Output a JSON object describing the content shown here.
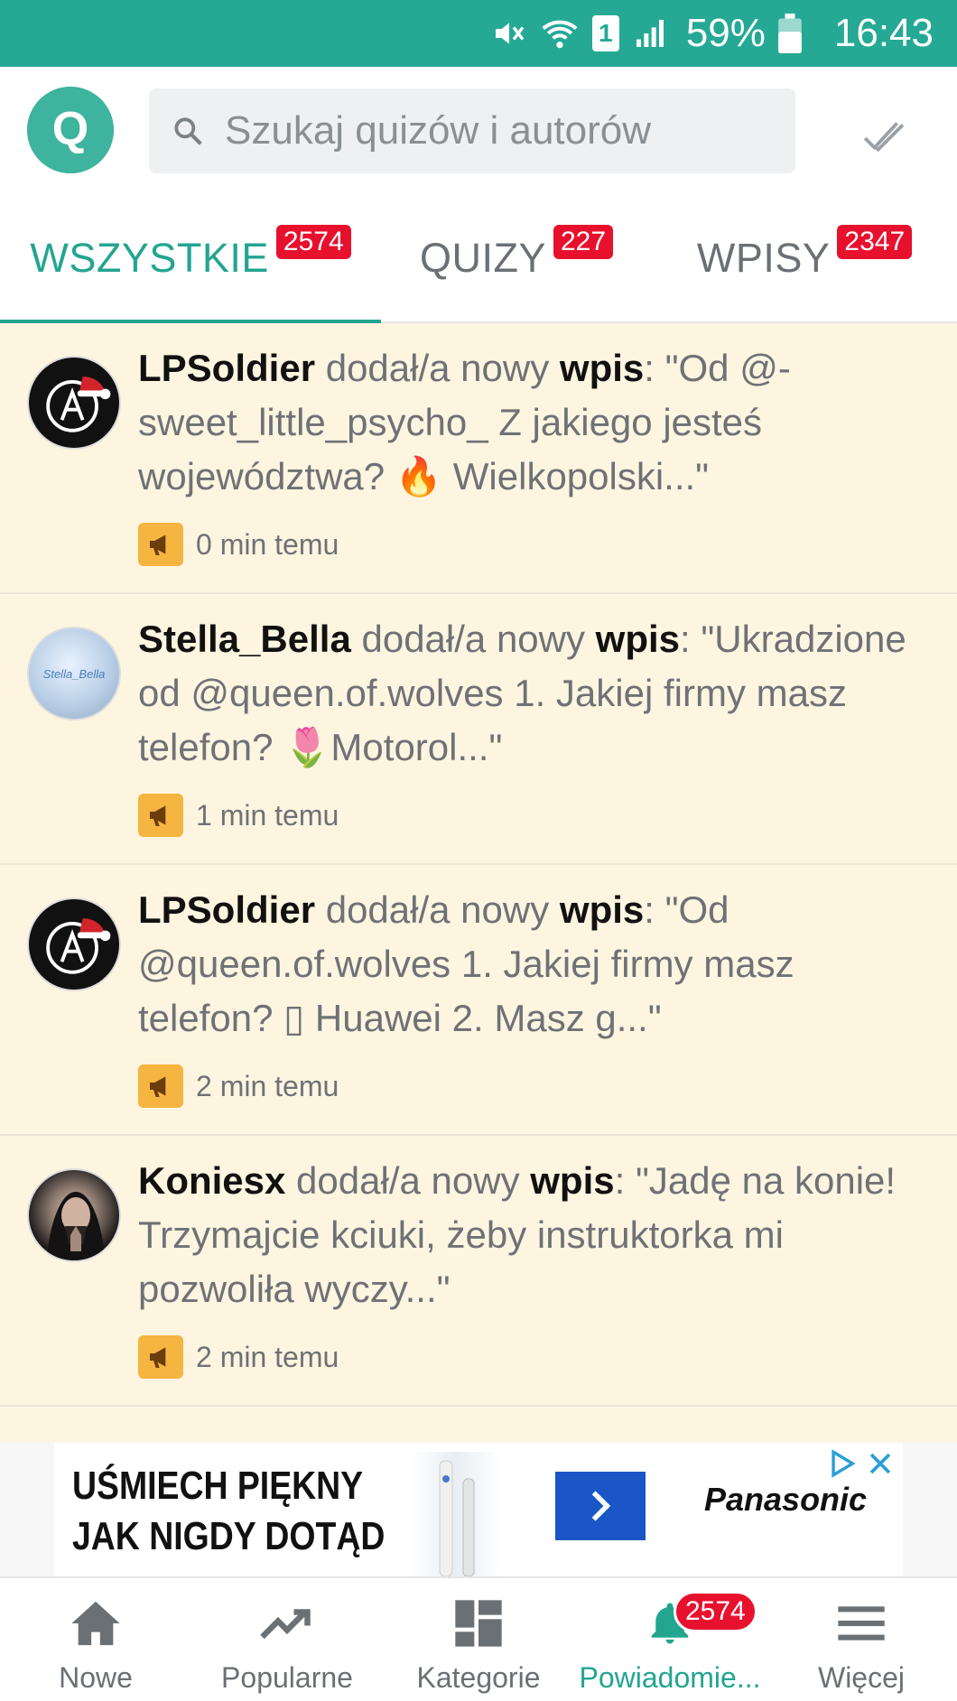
{
  "status_bar": {
    "battery_percent": "59%",
    "time": "16:43",
    "sim_label": "1",
    "icons": [
      "mute-icon",
      "wifi-icon",
      "sim-icon",
      "signal-icon",
      "battery-icon"
    ]
  },
  "app_bar": {
    "logo_letter": "Q",
    "search_placeholder": "Szukaj quizów i autorów",
    "icons": [
      "search-icon",
      "mark-all-read-icon"
    ]
  },
  "tabs": [
    {
      "label": "WSZYSTKIE",
      "badge": "2574",
      "active": true
    },
    {
      "label": "QUIZY",
      "badge": "227",
      "active": false
    },
    {
      "label": "WPISY",
      "badge": "2347",
      "active": false
    }
  ],
  "feed": {
    "items": [
      {
        "user": "LPSoldier",
        "action": " dodał/a nowy ",
        "kind": "wpis",
        "body": ": \"Od @-sweet_little_psycho_ Z jakiego jesteś województwa? 🔥 Wielkopolski...\"",
        "time": "0 min temu",
        "avatar": "lp"
      },
      {
        "user": "Stella_Bella",
        "action": " dodał/a nowy ",
        "kind": "wpis",
        "body": ": \"Ukradzione od @queen.of.wolves 1. Jakiej firmy masz telefon? 🌷Motorol...\"",
        "time": "1 min temu",
        "avatar": "stella",
        "avatar_text": "Stella_Bella"
      },
      {
        "user": "LPSoldier",
        "action": " dodał/a nowy ",
        "kind": "wpis",
        "body": ": \"Od @queen.of.wolves 1. Jakiej firmy masz telefon? ▯ Huawei 2. Masz g...\"",
        "time": "2 min temu",
        "avatar": "lp"
      },
      {
        "user": "Koniesx",
        "action": " dodał/a nowy ",
        "kind": "wpis",
        "body": ": \"Jadę na konie! Trzymajcie kciuki, żeby instruktorka mi pozwoliła wyczy...\"",
        "time": "2 min temu",
        "avatar": "kon"
      }
    ]
  },
  "ad": {
    "headline_line1": "UŚMIECH PIĘKNY",
    "headline_line2": "JAK NIGDY DOTĄD",
    "brand": "Panasonic",
    "icons": [
      "arrow-right-icon",
      "adchoices-icon",
      "close-icon"
    ]
  },
  "bottom_nav": [
    {
      "label": "Nowe",
      "icon": "home-icon",
      "active": false
    },
    {
      "label": "Popularne",
      "icon": "trending-icon",
      "active": false
    },
    {
      "label": "Kategorie",
      "icon": "categories-icon",
      "active": false
    },
    {
      "label": "Powiadomie...",
      "icon": "bell-icon",
      "active": true,
      "badge": "2574"
    },
    {
      "label": "Więcej",
      "icon": "menu-icon",
      "active": false
    }
  ],
  "colors": {
    "primary": "#25a995",
    "accent_text": "#23a590",
    "badge": "#e8112d",
    "feed_bg": "#fdf5e0",
    "megaphone": "#f6b441"
  }
}
